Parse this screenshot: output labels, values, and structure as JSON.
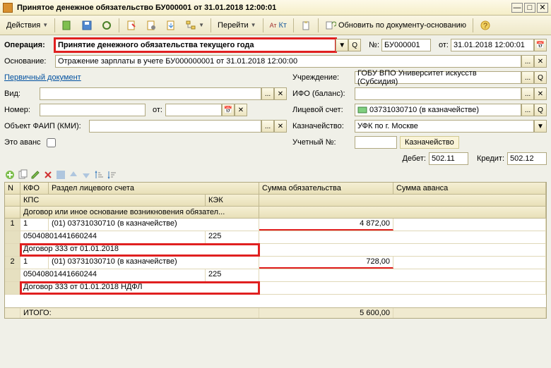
{
  "title": "Принятое денежное обязательство БУ000001 от 31.01.2018 12:00:01",
  "toolbar": {
    "actions": "Действия",
    "goto": "Перейти",
    "akt": "Ат\nКт",
    "refresh": "Обновить по документу-основанию"
  },
  "labels": {
    "operation": "Операция:",
    "number": "№:",
    "from": "от:",
    "basis": "Основание:",
    "primary_doc": "Первичный документ",
    "institution": "Учреждение:",
    "type": "Вид:",
    "ifo": "ИФО (баланс):",
    "num": "Номер:",
    "ot": "от:",
    "account": "Лицевой счет:",
    "faip": "Объект ФАИП (КМИ):",
    "treasury": "Казначейство:",
    "advance": "Это аванс",
    "accnum": "Учетный №:",
    "kaznach": "Казначейство",
    "debit": "Дебет:",
    "credit": "Кредит:"
  },
  "fields": {
    "operation": "Принятие денежного обязательства текущего года",
    "number": "БУ000001",
    "date": "31.01.2018 12:00:01",
    "basis": "Отражение зарплаты в учете БУ000000001 от 31.01.2018 12:00:00",
    "institution": "ГОБУ ВПО Университет искусств (Субсидия)",
    "account": "03731030710 (в казначействе)",
    "treasury": "УФК по г. Москве",
    "debit": "502.11",
    "credit": "502.12"
  },
  "grid": {
    "headers": {
      "n": "N",
      "kfo": "КФО",
      "razdel": "Раздел лицевого счета",
      "sum_obl": "Сумма обязательства",
      "sum_avans": "Сумма аванса",
      "kps": "КПС",
      "kek": "КЭК",
      "dogovor": "Договор или иное основание возникновения обязател..."
    },
    "rows": [
      {
        "n": "1",
        "kfo": "1",
        "razdel": "(01) 03731030710 (в казначействе)",
        "sum": "4 872,00",
        "kps": "05040801441660244",
        "kek": "225",
        "dogovor": "Договор 333 от 01.01.2018"
      },
      {
        "n": "2",
        "kfo": "1",
        "razdel": "(01) 03731030710 (в казначействе)",
        "sum": "728,00",
        "kps": "05040801441660244",
        "kek": "225",
        "dogovor": "Договор 333 от 01.01.2018  НДФЛ"
      }
    ],
    "footer": {
      "label": "ИТОГО:",
      "total": "5 600,00"
    }
  }
}
